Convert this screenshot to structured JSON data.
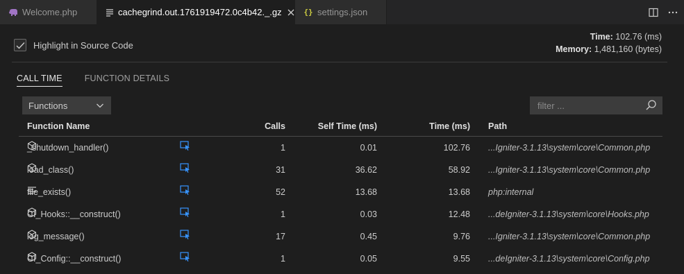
{
  "tabs": [
    {
      "label": "Welcome.php",
      "icon": "php-elephant-icon",
      "active": false
    },
    {
      "label": "cachegrind.out.1761919472.0c4b42._.gz",
      "icon": "file-lines-icon",
      "active": true
    },
    {
      "label": "settings.json",
      "icon": "json-braces-icon",
      "active": false
    }
  ],
  "header": {
    "highlight_label": "Highlight in Source Code",
    "highlight_checked": true,
    "time_label": "Time:",
    "time_value": "102.76 (ms)",
    "memory_label": "Memory:",
    "memory_value": "1,481,160 (bytes)"
  },
  "panel_tabs": {
    "call_time": "CALL TIME",
    "function_details": "FUNCTION DETAILS"
  },
  "controls": {
    "view_select": "Functions",
    "filter_placeholder": "filter ..."
  },
  "table": {
    "columns": {
      "name": "Function Name",
      "calls": "Calls",
      "self_time": "Self Time (ms)",
      "time": "Time (ms)",
      "path": "Path"
    },
    "rows": [
      {
        "icon": "cube-icon",
        "name": "_shutdown_handler()",
        "calls": "1",
        "self_time": "0.01",
        "time": "102.76",
        "path": "...Igniter-3.1.13\\system\\core\\Common.php"
      },
      {
        "icon": "cube-icon",
        "name": "load_class()",
        "calls": "31",
        "self_time": "36.62",
        "time": "58.92",
        "path": "...Igniter-3.1.13\\system\\core\\Common.php"
      },
      {
        "icon": "internal-function-icon",
        "name": "file_exists()",
        "calls": "52",
        "self_time": "13.68",
        "time": "13.68",
        "path": "php:internal"
      },
      {
        "icon": "cube-icon",
        "name": "CI_Hooks::__construct()",
        "calls": "1",
        "self_time": "0.03",
        "time": "12.48",
        "path": "...deIgniter-3.1.13\\system\\core\\Hooks.php"
      },
      {
        "icon": "cube-icon",
        "name": "log_message()",
        "calls": "17",
        "self_time": "0.45",
        "time": "9.76",
        "path": "...Igniter-3.1.13\\system\\core\\Common.php"
      },
      {
        "icon": "cube-icon",
        "name": "CI_Config::__construct()",
        "calls": "1",
        "self_time": "0.05",
        "time": "9.55",
        "path": "...deIgniter-3.1.13\\system\\core\\Config.php"
      }
    ]
  },
  "colors": {
    "background": "#1e1e1e",
    "tabbar": "#252526",
    "input_bg": "#3c3c3c",
    "accent_link": "#3794ff",
    "json_icon": "#cbcb41",
    "php_icon": "#a074c4"
  }
}
